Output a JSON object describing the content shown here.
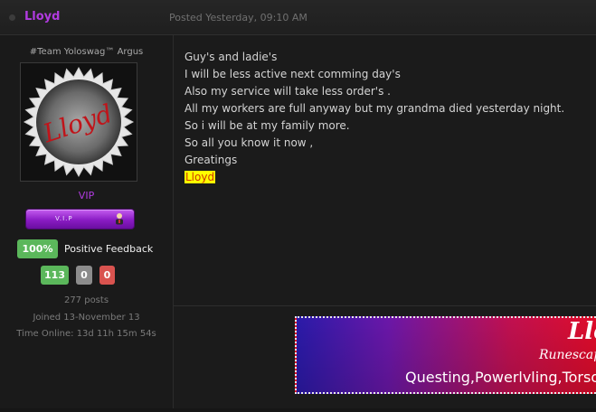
{
  "post": {
    "username": "Lloyd",
    "posted_label": "Posted Yesterday, 09:10 AM",
    "body_lines": [
      "Guy's and ladie's",
      "",
      "I will be less active next comming day's",
      "Also my service will take less order's .",
      "All my workers are full anyway but my grandma died yesterday night.",
      "So i will be at my family more.",
      "",
      "So all you know it now ,",
      "",
      "Greatings"
    ],
    "signature_name": "Lloyd"
  },
  "author": {
    "title": "#Team Yoloswag™ Argus",
    "avatar_text": "Lloyd",
    "group": "VIP",
    "group_bar_label": "V.I.P",
    "feedback_percent": "100%",
    "feedback_label": "Positive Feedback",
    "positive": "113",
    "neutral": "0",
    "negative": "0",
    "posts": "277 posts",
    "joined": "Joined 13-November 13",
    "time_online": "Time Online: 13d 11h 15m 54s"
  },
  "banner": {
    "title": "Lloyd",
    "subtitle": "Runescape",
    "services": "Questing,Powerlvling,Torso"
  },
  "colors": {
    "username": "#b13be0",
    "feedback_green": "#5bb75b",
    "neutral_gray": "#8c8c8c",
    "negative_red": "#d9534f",
    "highlight": "#ffff00"
  }
}
